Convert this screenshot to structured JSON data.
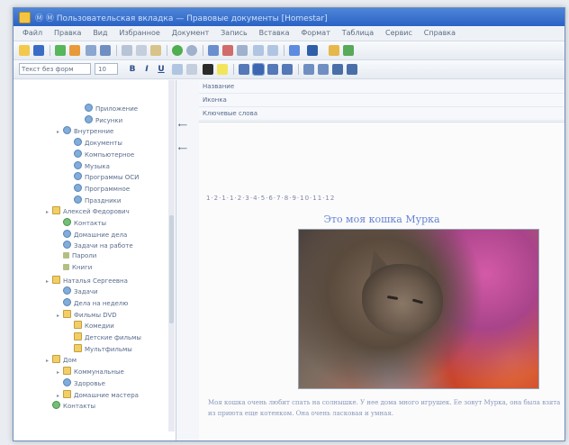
{
  "window": {
    "title": "Ⓜ Ⓜ Пользовательская вкладка — Правовые документы [Homestar]"
  },
  "menu": [
    "Файл",
    "Правка",
    "Вид",
    "Избранное",
    "Документ",
    "Запись",
    "Вставка",
    "Формат",
    "Таблица",
    "Сервис",
    "Справка"
  ],
  "toolbar2": {
    "style_value": "Текст без форм",
    "size_value": "10"
  },
  "tree": [
    {
      "level": 3,
      "icon": "blue",
      "label": "Приложение"
    },
    {
      "level": 3,
      "icon": "blue",
      "label": "Рисунки"
    },
    {
      "level": 1,
      "icon": "blue",
      "label": "Внутренние"
    },
    {
      "level": 2,
      "icon": "blue",
      "label": "Документы"
    },
    {
      "level": 2,
      "icon": "blue",
      "label": "Компьютерное"
    },
    {
      "level": 2,
      "icon": "blue",
      "label": "Музыка"
    },
    {
      "level": 2,
      "icon": "blue",
      "label": "Программы ОСИ"
    },
    {
      "level": 2,
      "icon": "blue",
      "label": "Программное"
    },
    {
      "level": 2,
      "icon": "blue",
      "label": "Праздники"
    },
    {
      "level": 0,
      "icon": "folder",
      "label": "Алексей Федорович"
    },
    {
      "level": 1,
      "icon": "green",
      "label": "Контакты"
    },
    {
      "level": 1,
      "icon": "blue",
      "label": "Домашние дела"
    },
    {
      "level": 1,
      "icon": "blue",
      "label": "Задачи на работе"
    },
    {
      "level": 1,
      "icon": "pen",
      "label": "Пароли"
    },
    {
      "level": 1,
      "icon": "pen",
      "label": "Книги"
    },
    {
      "level": 0,
      "icon": "folder",
      "label": "Наталья Сергеевна"
    },
    {
      "level": 1,
      "icon": "blue",
      "label": "Задачи"
    },
    {
      "level": 1,
      "icon": "blue",
      "label": "Дела на неделю"
    },
    {
      "level": 1,
      "icon": "folder",
      "label": "Фильмы DVD"
    },
    {
      "level": 2,
      "icon": "folder",
      "label": "Комедии"
    },
    {
      "level": 2,
      "icon": "folder",
      "label": "Детские фильмы"
    },
    {
      "level": 2,
      "icon": "folder",
      "label": "Мультфильмы"
    },
    {
      "level": 0,
      "icon": "folder",
      "label": "Дом"
    },
    {
      "level": 1,
      "icon": "folder",
      "label": "Коммунальные"
    },
    {
      "level": 1,
      "icon": "blue",
      "label": "Здоровье"
    },
    {
      "level": 1,
      "icon": "folder",
      "label": "Домашние мастера"
    },
    {
      "level": 0,
      "icon": "green",
      "label": "Контакты"
    }
  ],
  "properties": [
    "Название",
    "Иконка",
    "Ключевые слова"
  ],
  "ruler": "1·2·1·1·2·3·4·5·6·7·8·9·10·11·12",
  "document": {
    "heading": "Это моя кошка Мурка",
    "paragraph": "Моя кошка очень любит спать на солнышке. У нее дома много игрушек. Ее зовут Мурка, она была взята из приюта еще котенком. Она очень ласковая и умная."
  }
}
